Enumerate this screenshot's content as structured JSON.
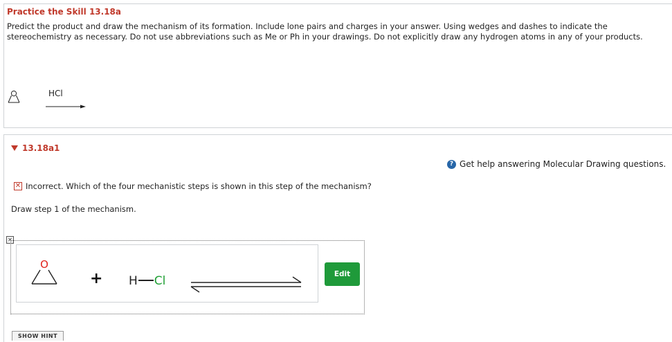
{
  "header": {
    "title": "Practice the Skill 13.18a",
    "prompt": "Predict the product and draw the mechanism of its formation. Include lone pairs and charges in your answer. Using wedges and dashes to indicate the stereochemistry as necessary. Do not use abbreviations such as Me or Ph in your drawings. Do not explicitly draw any hydrogen atoms in any of your products."
  },
  "reaction": {
    "reagent": "HCl",
    "reactant_atom": "O"
  },
  "question": {
    "label": "13.18a1",
    "help_text": "Get help answering Molecular Drawing questions.",
    "feedback": "Incorrect. Which of the four mechanistic steps is shown in this step of the mechanism?",
    "instruction": "Draw step 1 of the mechanism."
  },
  "drawing": {
    "epoxide_atom": "O",
    "plus": "+",
    "h": "H",
    "cl": "Cl"
  },
  "buttons": {
    "edit": "Edit",
    "show_hint": "SHOW HINT"
  },
  "colors": {
    "accent_red": "#c0392b",
    "edit_green": "#1f9a3a",
    "help_blue": "#2766a8",
    "chlorine_green": "#21a036"
  }
}
